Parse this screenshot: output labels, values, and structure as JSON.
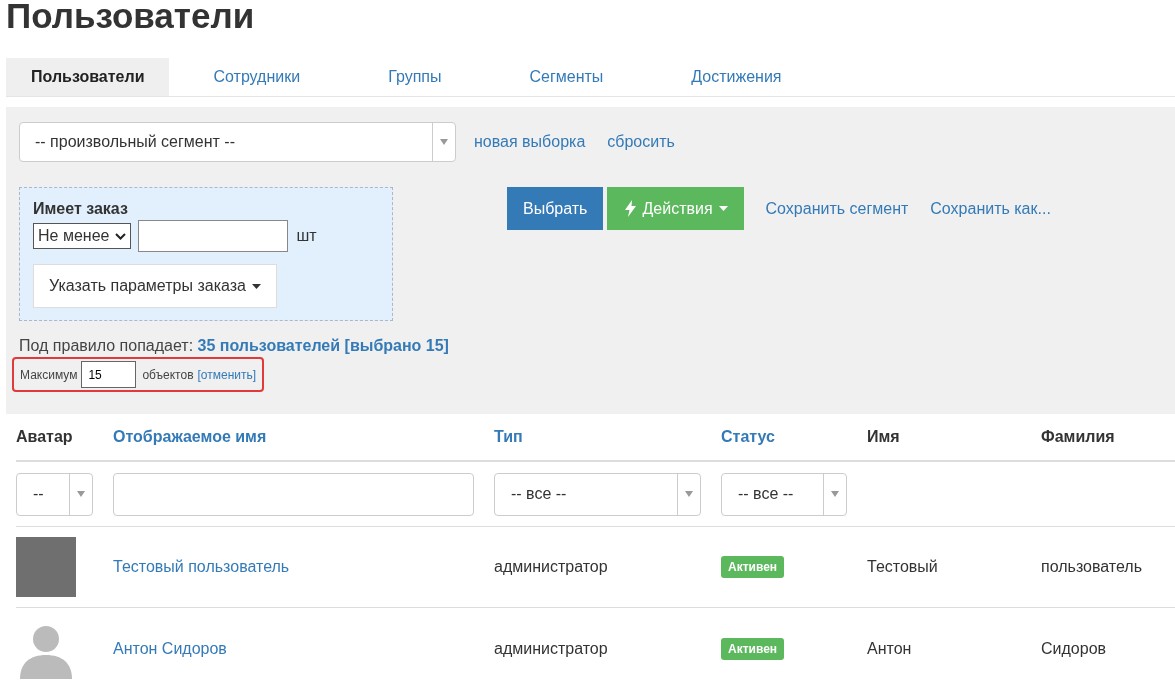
{
  "title": "Пользователи",
  "tabs": [
    {
      "label": "Пользователи",
      "selected": true
    },
    {
      "label": "Сотрудники",
      "selected": false
    },
    {
      "label": "Группы",
      "selected": false
    },
    {
      "label": "Сегменты",
      "selected": false
    },
    {
      "label": "Достижения",
      "selected": false
    }
  ],
  "segment_select": {
    "value": "-- произвольный сегмент --"
  },
  "segment_links": [
    "новая выборка",
    "сбросить"
  ],
  "rule": {
    "title": "Имеет заказ",
    "operator": "Не менее",
    "unit": "шт",
    "params_button": "Указать параметры заказа"
  },
  "actions": [
    {
      "kind": "primary",
      "label": "Выбрать"
    },
    {
      "kind": "success",
      "label": "Действия"
    },
    {
      "kind": "link",
      "label": "Сохранить сегмент"
    },
    {
      "kind": "link",
      "label": "Сохранить как..."
    }
  ],
  "summary": {
    "prefix": "Под правило попадает:",
    "link": "35 пользователей [выбрано 15]"
  },
  "limit": {
    "label": "Максимум",
    "value": "15",
    "suffix": "объектов",
    "cancel": "[отменить]",
    "highlighted": true
  },
  "table": {
    "columns": [
      {
        "label": "Аватар",
        "sortable": false
      },
      {
        "label": "Отображаемое имя",
        "sortable": true
      },
      {
        "label": "Тип",
        "sortable": true
      },
      {
        "label": "Статус",
        "sortable": true
      },
      {
        "label": "Имя",
        "sortable": false
      },
      {
        "label": "Фамилия",
        "sortable": false
      }
    ],
    "filters": [
      {
        "kind": "select",
        "value": "--"
      },
      {
        "kind": "text"
      },
      {
        "kind": "select",
        "value": "-- все --"
      },
      {
        "kind": "select",
        "value": "-- все --"
      },
      {
        "kind": "none"
      },
      {
        "kind": "none"
      }
    ],
    "rows": [
      {
        "has_photo": true,
        "display_name": "Тестовый пользователь",
        "type": "администратор",
        "status": "Активен",
        "first_name": "Тестовый",
        "last_name": "пользователь"
      },
      {
        "has_photo": false,
        "display_name": "Антон Сидоров",
        "type": "администратор",
        "status": "Активен",
        "first_name": "Антон",
        "last_name": "Сидоров"
      }
    ]
  }
}
